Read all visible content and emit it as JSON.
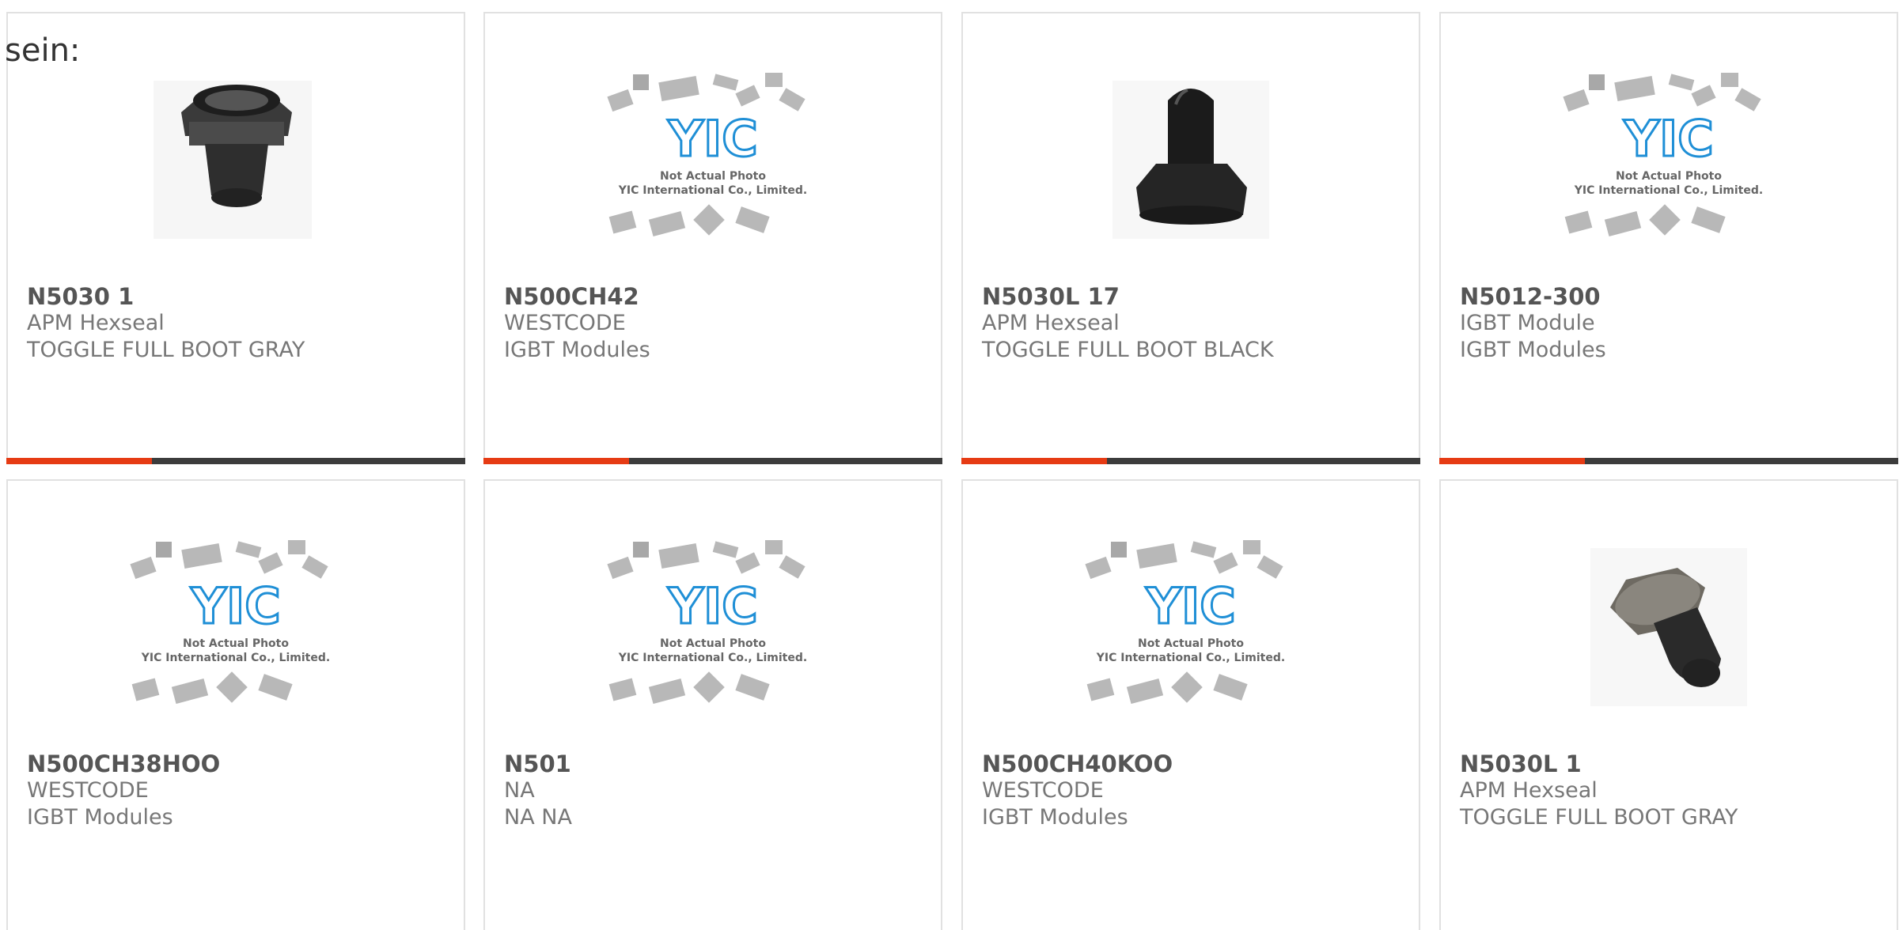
{
  "page": {
    "heading": "sein:"
  },
  "placeholder_image": {
    "line1": "Not Actual Photo",
    "line2": "YIC International Co., Limited.",
    "logo": "YIC"
  },
  "colors": {
    "accent": "#e63b14",
    "bar_dark": "#3c3c3c",
    "logo_blue": "#1f8fd6"
  },
  "products": [
    {
      "part": "N5030 1",
      "manufacturer": "APM Hexseal",
      "description": "TOGGLE FULL BOOT GRAY",
      "image": "hex-nut-boot-photo"
    },
    {
      "part": "N500CH42",
      "manufacturer": "WESTCODE",
      "description": "IGBT Modules",
      "image": "yic-placeholder"
    },
    {
      "part": "N5030L 17",
      "manufacturer": "APM Hexseal",
      "description": "TOGGLE FULL BOOT BLACK",
      "image": "black-boot-photo"
    },
    {
      "part": "N5012-300",
      "manufacturer": "IGBT Module",
      "description": "IGBT Modules",
      "image": "yic-placeholder"
    },
    {
      "part": "N500CH38HOO",
      "manufacturer": "WESTCODE",
      "description": "IGBT Modules",
      "image": "yic-placeholder"
    },
    {
      "part": "N501",
      "manufacturer": "NA",
      "description": "NA NA",
      "image": "yic-placeholder"
    },
    {
      "part": "N500CH40KOO",
      "manufacturer": "WESTCODE",
      "description": "IGBT Modules",
      "image": "yic-placeholder"
    },
    {
      "part": "N5030L 1",
      "manufacturer": "APM Hexseal",
      "description": "TOGGLE FULL BOOT GRAY",
      "image": "gray-boot-photo"
    }
  ]
}
